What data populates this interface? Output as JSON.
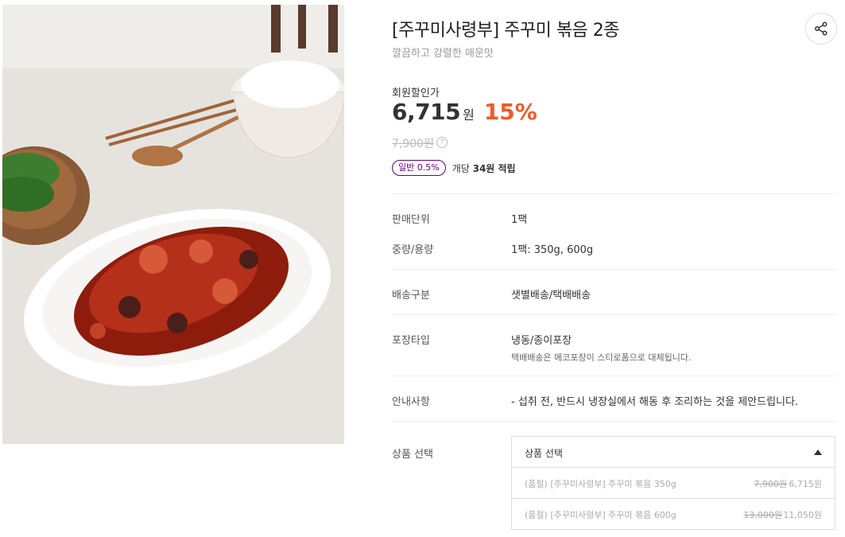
{
  "product": {
    "title": "[주꾸미사령부] 주꾸미 볶음 2종",
    "subtitle": "깔끔하고 강렬한 매운맛",
    "price_label": "회원할인가",
    "price": "6,715",
    "price_unit": "원",
    "discount": "15%",
    "original_price": "7,900원",
    "badge": "일반 0.5%",
    "points_prefix": "개당 ",
    "points_value": "34원 적립"
  },
  "specs": [
    {
      "label": "판매단위",
      "value": "1팩"
    },
    {
      "label": "중량/용량",
      "value": "1팩: 350g, 600g"
    },
    {
      "label": "배송구분",
      "value": "샛별배송/택배배송"
    },
    {
      "label": "포장타입",
      "value": "냉동/종이포장",
      "sub": "택배배송은 에코포장이 스티로폼으로 대체됩니다."
    },
    {
      "label": "안내사항",
      "value": "- 섭취 전, 반드시 냉장실에서 해동 후 조리하는 것을 제안드립니다."
    }
  ],
  "select": {
    "label": "상품 선택",
    "placeholder": "상품 선택",
    "options": [
      {
        "name": "(품절) [주꾸미사령부] 주꾸미 볶음 350g",
        "original": "7,900원",
        "price": "6,715원"
      },
      {
        "name": "(품절) [주꾸미사령부] 주꾸미 볶음 600g",
        "original": "13,000원",
        "price": "11,050원"
      }
    ]
  },
  "icons": {
    "share": "share-icon",
    "help": "question-circle-icon",
    "dropdown": "caret-up-icon"
  },
  "colors": {
    "accent": "#f05a28",
    "brand": "#5f0080"
  }
}
